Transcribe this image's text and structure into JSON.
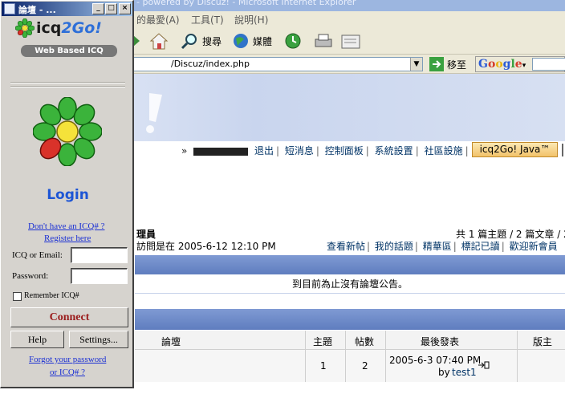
{
  "ie": {
    "title": "- powered by Discuz! - Microsoft Internet Explorer",
    "menu": [
      "的最愛(A)",
      "工具(T)",
      "說明(H)"
    ],
    "toolbar": {
      "search": "搜尋",
      "media": "媒體"
    },
    "address": "/Discuz/index.php",
    "go": "移至",
    "google": "Google"
  },
  "forum": {
    "user_nav": [
      "退出",
      "短消息",
      "控制面板",
      "系統設置",
      "社區設施"
    ],
    "java_button": "icq2Go! Java™",
    "stats_left": "理員",
    "stats_right": "共 1 篇主題 / 2 篇文章 / 2",
    "last_visit": "訪問是在 2005-6-12 12:10 PM",
    "links": [
      "查看新帖",
      "我的話題",
      "精華區",
      "標記已讀",
      "歡迎新會員"
    ],
    "announcement": "到目前為止沒有論壇公告。",
    "table_headers": {
      "forum": "論壇",
      "topics": "主題",
      "posts": "帖數",
      "last_post": "最後發表",
      "moderator": "版主"
    },
    "row": {
      "topics": "1",
      "posts": "2",
      "last_post_date": "2005-6-3 07:40 PM",
      "by_prefix": "by",
      "by_user": "test1"
    }
  },
  "icq": {
    "window_title": "論壇 - ...",
    "logo_prefix": "icq",
    "logo_suffix": "2Go!",
    "badge": "Web Based ICQ",
    "login_title": "Login",
    "no_icq_link": "Don't have an ICQ# ?",
    "register_link": "Register here",
    "email_label": "ICQ or Email:",
    "password_label": "Password:",
    "remember_label": "Remember ICQ#",
    "connect_button": "Connect",
    "help_button": "Help",
    "settings_button": "Settings...",
    "forgot_link_1": "Forgot your password",
    "forgot_link_2": "or ICQ# ?"
  },
  "colors": {
    "icq_blue": "#1d55d5",
    "connect_red": "#9a1b1b",
    "flower_green": "#3bb33b",
    "forum_bar": "#6d89c8"
  }
}
